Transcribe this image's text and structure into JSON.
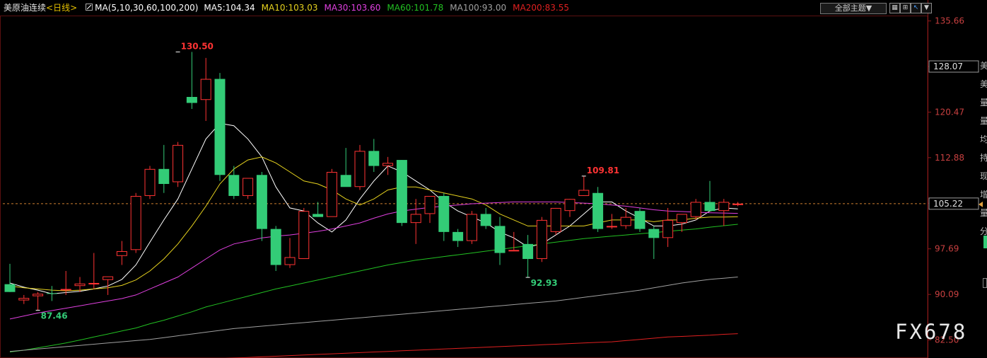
{
  "header": {
    "symbol": "美原油连续",
    "period": "<日线>",
    "ma_params": "MA(5,10,30,60,100,200)",
    "ma_items": [
      {
        "label": "MA5:104.34",
        "color": "#ffffff"
      },
      {
        "label": "MA10:103.03",
        "color": "#e6d21e"
      },
      {
        "label": "MA30:103.60",
        "color": "#e040e0"
      },
      {
        "label": "MA60:101.78",
        "color": "#22c022"
      },
      {
        "label": "MA100:93.00",
        "color": "#a0a0a0"
      },
      {
        "label": "MA200:83.55",
        "color": "#e02020"
      }
    ],
    "theme_label": "全部主题▼",
    "tool_icons": [
      "grid-icon",
      "expand-icon",
      "pointer-icon",
      "arrow-down-icon"
    ]
  },
  "right_strip_chars": [
    "美",
    "美",
    "量",
    "量",
    "均",
    "持",
    "现",
    "增",
    "量",
    "分"
  ],
  "watermark": "FX678",
  "colors": {
    "up": "#ff3333",
    "down": "#33cc77",
    "bg": "#000000",
    "grid": "#3a0a0a",
    "axis_text": "#c84040",
    "dash": "#d08030"
  },
  "chart_data": {
    "type": "candlestick",
    "ylim": [
      79.5,
      137.5
    ],
    "y_ticks": [
      "135.66",
      "128.07",
      "120.47",
      "112.88",
      "105.28",
      "97.69",
      "90.09",
      "82.50"
    ],
    "current_price": "105.22",
    "crosshair_label": "128.07",
    "annotations": [
      {
        "text": "130.50",
        "index": 12,
        "value": 130.5,
        "color": "#ff3333"
      },
      {
        "text": "87.46",
        "index": 2,
        "value": 87.46,
        "color": "#33cc77"
      },
      {
        "text": "109.81",
        "index": 41,
        "value": 109.81,
        "color": "#ff3333"
      },
      {
        "text": "92.93",
        "index": 37,
        "value": 92.93,
        "color": "#33cc77"
      }
    ],
    "candles": [
      [
        91.8,
        95.2,
        90.5,
        90.5
      ],
      [
        89.1,
        90.0,
        88.5,
        89.5
      ],
      [
        89.8,
        90.5,
        87.4,
        90.2
      ],
      [
        90.3,
        91.5,
        89.0,
        90.2
      ],
      [
        90.8,
        94.0,
        90.0,
        91.0
      ],
      [
        91.5,
        93.0,
        90.5,
        91.9
      ],
      [
        91.9,
        97.0,
        91.0,
        92.0
      ],
      [
        92.5,
        93.0,
        90.0,
        93.1
      ],
      [
        96.5,
        99.0,
        95.0,
        97.3
      ],
      [
        97.5,
        107.0,
        97.0,
        106.5
      ],
      [
        106.5,
        111.5,
        106.0,
        111.0
      ],
      [
        111.0,
        115.0,
        107.0,
        108.5
      ],
      [
        108.8,
        115.5,
        108.0,
        115.0
      ],
      [
        123.0,
        130.5,
        121.0,
        122.0
      ],
      [
        122.5,
        129.5,
        119.0,
        126.0
      ],
      [
        126.0,
        127.0,
        109.0,
        110.0
      ],
      [
        110.0,
        111.5,
        106.0,
        106.5
      ],
      [
        106.5,
        109.0,
        106.0,
        109.5
      ],
      [
        110.0,
        110.5,
        99.0,
        101.0
      ],
      [
        101.0,
        101.5,
        94.0,
        95.0
      ],
      [
        95.0,
        99.5,
        94.5,
        96.3
      ],
      [
        96.0,
        104.5,
        96.0,
        104.0
      ],
      [
        103.5,
        105.5,
        103.0,
        103.0
      ],
      [
        103.0,
        111.0,
        103.5,
        110.5
      ],
      [
        110.0,
        114.5,
        109.0,
        108.0
      ],
      [
        108.0,
        115.0,
        107.5,
        114.0
      ],
      [
        114.0,
        116.0,
        110.5,
        111.5
      ],
      [
        111.5,
        113.0,
        110.0,
        112.0
      ],
      [
        112.5,
        112.5,
        101.5,
        102.0
      ],
      [
        102.0,
        106.0,
        98.5,
        103.5
      ],
      [
        103.5,
        106.5,
        102.0,
        106.5
      ],
      [
        106.5,
        107.0,
        99.0,
        100.5
      ],
      [
        100.5,
        101.0,
        98.0,
        99.0
      ],
      [
        99.0,
        104.0,
        98.5,
        103.5
      ],
      [
        103.5,
        104.5,
        101.0,
        101.5
      ],
      [
        101.5,
        103.0,
        95.0,
        97.0
      ],
      [
        97.5,
        100.5,
        97.5,
        97.5
      ],
      [
        98.5,
        100.0,
        92.9,
        96.0
      ],
      [
        96.0,
        103.0,
        95.5,
        102.5
      ],
      [
        100.5,
        104.5,
        100.0,
        104.5
      ],
      [
        104.0,
        106.0,
        103.0,
        106.0
      ],
      [
        106.5,
        109.8,
        106.5,
        107.5
      ],
      [
        107.0,
        108.0,
        100.5,
        101.0
      ],
      [
        101.5,
        103.5,
        101.0,
        101.5
      ],
      [
        101.5,
        104.5,
        101.0,
        103.0
      ],
      [
        104.0,
        104.5,
        100.5,
        101.0
      ],
      [
        101.0,
        101.5,
        96.0,
        99.5
      ],
      [
        99.5,
        104.5,
        98.0,
        102.5
      ],
      [
        102.0,
        103.5,
        100.5,
        103.5
      ],
      [
        103.0,
        106.0,
        102.5,
        105.5
      ],
      [
        105.5,
        109.0,
        104.0,
        104.0
      ],
      [
        104.0,
        106.0,
        101.5,
        105.5
      ],
      [
        105.0,
        105.5,
        104.8,
        105.22
      ]
    ],
    "series": [
      {
        "name": "MA5",
        "color": "#ffffff",
        "values": [
          92.0,
          91.3,
          90.8,
          90.2,
          90.4,
          90.6,
          91.0,
          91.5,
          92.6,
          95.0,
          98.8,
          102.5,
          106.0,
          111.0,
          116.0,
          118.6,
          118.2,
          116.0,
          113.0,
          108.0,
          104.5,
          104.0,
          102.0,
          100.5,
          102.5,
          106.0,
          109.0,
          111.5,
          110.5,
          109.0,
          107.5,
          105.5,
          104.0,
          103.0,
          102.0,
          100.5,
          99.5,
          98.0,
          98.5,
          100.0,
          101.5,
          103.5,
          105.5,
          105.5,
          104.0,
          102.8,
          101.5,
          101.5,
          101.8,
          102.5,
          104.0,
          104.5,
          104.34
        ]
      },
      {
        "name": "MA10",
        "color": "#e6d21e",
        "values": [
          91.5,
          91.2,
          91.0,
          90.8,
          90.7,
          90.8,
          91.0,
          91.2,
          91.6,
          92.5,
          94.0,
          96.0,
          98.5,
          101.5,
          104.8,
          108.5,
          111.0,
          112.5,
          113.0,
          112.0,
          110.5,
          109.0,
          108.5,
          107.5,
          106.0,
          105.0,
          106.0,
          107.5,
          108.0,
          108.0,
          107.5,
          107.0,
          106.5,
          106.0,
          105.0,
          103.5,
          102.5,
          101.5,
          101.5,
          101.5,
          101.5,
          101.5,
          102.0,
          102.5,
          102.5,
          102.5,
          102.2,
          102.5,
          102.5,
          102.8,
          103.0,
          103.0,
          103.03
        ]
      },
      {
        "name": "MA30",
        "color": "#e040e0",
        "values": [
          86.0,
          86.5,
          87.0,
          87.4,
          87.8,
          88.2,
          88.6,
          89.0,
          89.4,
          90.0,
          91.0,
          92.0,
          93.0,
          94.5,
          96.0,
          97.5,
          98.5,
          99.0,
          99.5,
          99.8,
          100.0,
          100.3,
          100.6,
          101.0,
          101.5,
          102.0,
          102.8,
          103.5,
          104.0,
          104.3,
          104.6,
          104.8,
          105.0,
          105.2,
          105.3,
          105.4,
          105.5,
          105.5,
          105.5,
          105.5,
          105.4,
          105.3,
          105.2,
          105.0,
          104.8,
          104.5,
          104.2,
          104.0,
          103.9,
          103.8,
          103.7,
          103.65,
          103.6
        ]
      },
      {
        "name": "MA60",
        "color": "#22c022",
        "values": [
          80.5,
          80.8,
          81.2,
          81.6,
          82.0,
          82.5,
          83.0,
          83.5,
          84.0,
          84.5,
          85.2,
          85.8,
          86.5,
          87.2,
          88.0,
          88.6,
          89.2,
          89.8,
          90.4,
          91.0,
          91.5,
          92.0,
          92.5,
          93.0,
          93.5,
          94.0,
          94.5,
          95.0,
          95.4,
          95.8,
          96.1,
          96.4,
          96.7,
          97.0,
          97.3,
          97.6,
          97.9,
          98.2,
          98.5,
          98.8,
          99.1,
          99.4,
          99.6,
          99.8,
          100.0,
          100.2,
          100.4,
          100.6,
          100.8,
          101.0,
          101.3,
          101.55,
          101.78
        ]
      },
      {
        "name": "MA100",
        "color": "#a0a0a0",
        "values": [
          80.6,
          80.8,
          81.0,
          81.2,
          81.4,
          81.6,
          81.8,
          82.0,
          82.2,
          82.4,
          82.6,
          82.9,
          83.2,
          83.5,
          83.8,
          84.1,
          84.4,
          84.6,
          84.8,
          85.0,
          85.2,
          85.4,
          85.6,
          85.8,
          86.0,
          86.2,
          86.4,
          86.6,
          86.8,
          87.0,
          87.2,
          87.4,
          87.6,
          87.8,
          88.0,
          88.2,
          88.4,
          88.6,
          88.8,
          89.0,
          89.3,
          89.6,
          89.9,
          90.2,
          90.5,
          90.8,
          91.2,
          91.6,
          92.0,
          92.3,
          92.6,
          92.8,
          93.0
        ]
      },
      {
        "name": "MA200",
        "color": "#e02020",
        "values": [
          77.8,
          78.0,
          78.1,
          78.2,
          78.3,
          78.4,
          78.5,
          78.6,
          78.7,
          78.8,
          78.9,
          79.0,
          79.1,
          79.2,
          79.3,
          79.4,
          79.5,
          79.6,
          79.7,
          79.8,
          79.9,
          80.0,
          80.1,
          80.2,
          80.3,
          80.4,
          80.5,
          80.6,
          80.7,
          80.8,
          80.9,
          81.0,
          81.1,
          81.2,
          81.3,
          81.4,
          81.5,
          81.6,
          81.7,
          81.8,
          81.9,
          82.0,
          82.1,
          82.2,
          82.4,
          82.6,
          82.8,
          83.0,
          83.1,
          83.2,
          83.3,
          83.45,
          83.55
        ]
      }
    ]
  }
}
